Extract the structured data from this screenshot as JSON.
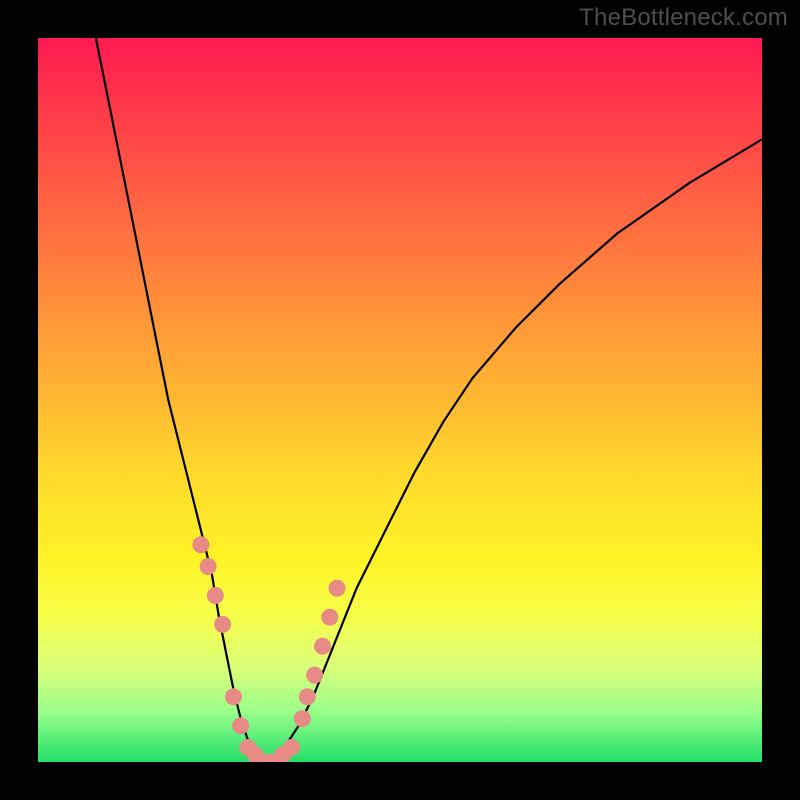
{
  "watermark": "TheBottleneck.com",
  "chart_data": {
    "type": "line",
    "title": "",
    "xlabel": "",
    "ylabel": "",
    "xlim": [
      0,
      100
    ],
    "ylim": [
      0,
      100
    ],
    "grid": false,
    "series": [
      {
        "name": "curve",
        "x": [
          8,
          10,
          12,
          14,
          16,
          18,
          20,
          22,
          24,
          25,
          26,
          27,
          28,
          29,
          30,
          31,
          32,
          33,
          34,
          36,
          38,
          40,
          44,
          48,
          52,
          56,
          60,
          66,
          72,
          80,
          90,
          100
        ],
        "y": [
          100,
          90,
          80,
          70,
          60,
          50,
          42,
          34,
          26,
          20,
          15,
          10,
          6,
          3,
          1,
          0,
          0,
          1,
          2,
          5,
          9,
          14,
          24,
          32,
          40,
          47,
          53,
          60,
          66,
          73,
          80,
          86
        ]
      }
    ],
    "markers": {
      "name": "dots",
      "x": [
        22.5,
        23.5,
        24.5,
        25.5,
        27,
        28,
        29,
        30,
        30.8,
        31.8,
        32.8,
        33.8,
        35,
        36.5,
        37.2,
        38.2,
        39.3,
        40.3,
        41.3
      ],
      "y": [
        30,
        27,
        23,
        19,
        9,
        5,
        2,
        1,
        0,
        0,
        0,
        1,
        2,
        6,
        9,
        12,
        16,
        20,
        24
      ]
    },
    "background_gradient": [
      "#ff1a50",
      "#ffd92c",
      "#22e06a"
    ]
  }
}
